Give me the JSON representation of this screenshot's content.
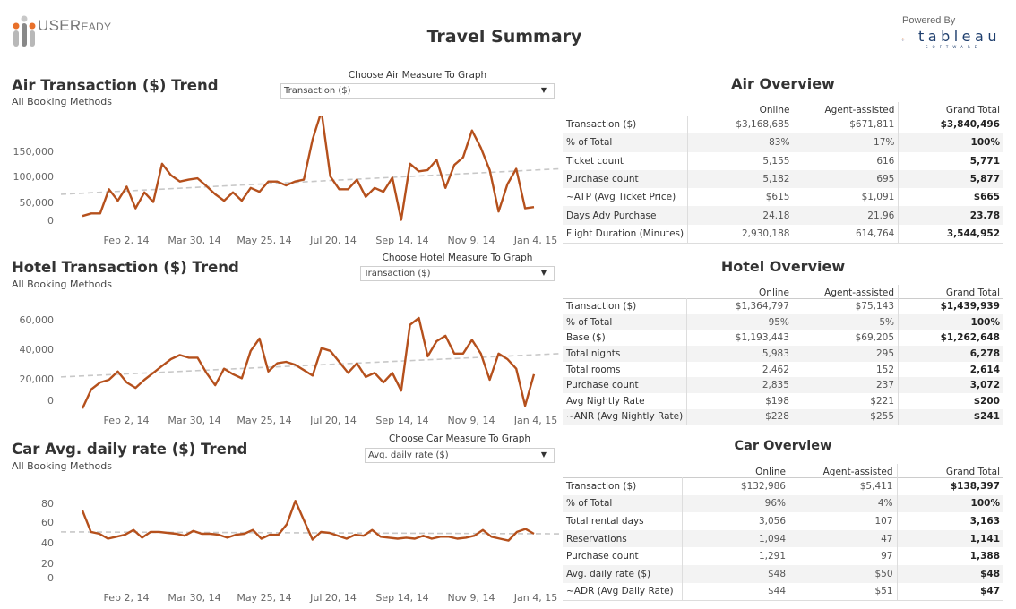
{
  "header": {
    "brand": "USER",
    "brand_suffix": "EADY",
    "title": "Travel Summary",
    "powered_by": "Powered By",
    "tableau_word": "tableau",
    "tableau_sub": "SOFTWARE"
  },
  "colors": {
    "line": "#b5501c",
    "trend": "#c8c8c8",
    "logo_orange": "#e8702a",
    "logo_gray": "#a0a0a0"
  },
  "air_panel": {
    "title": "Air Transaction ($) Trend",
    "subtitle": "All Booking Methods",
    "param_label": "Choose Air Measure To Graph",
    "param_value": "Transaction ($)"
  },
  "hotel_panel": {
    "title": "Hotel Transaction ($) Trend",
    "subtitle": "All Booking Methods",
    "param_label": "Choose Hotel Measure To Graph",
    "param_value": "Transaction ($)"
  },
  "car_panel": {
    "title": "Car Avg. daily rate ($) Trend",
    "subtitle": "All Booking Methods",
    "param_label": "Choose Car Measure To Graph",
    "param_value": "Avg. daily rate ($)"
  },
  "chart_data": [
    {
      "type": "line",
      "title": "Air Transaction ($) Trend",
      "subtitle": "All Booking Methods",
      "xlabel": "",
      "ylabel": "Transaction ($)",
      "x_ticks": [
        "Feb 2, 14",
        "Mar 30, 14",
        "May 25, 14",
        "Jul 20, 14",
        "Sep 14, 14",
        "Nov 9, 14",
        "Jan 4, 15"
      ],
      "y_ticks": [
        "0",
        "50,000",
        "100,000",
        "150,000"
      ],
      "ylim": [
        0,
        160000
      ],
      "trend_line": {
        "start": 52000,
        "end": 92000
      },
      "series": [
        {
          "name": "Transaction ($)",
          "values": [
            18000,
            22000,
            22000,
            60000,
            42000,
            64000,
            30000,
            55000,
            40000,
            100000,
            82000,
            72000,
            75000,
            77000,
            65000,
            52000,
            42000,
            55000,
            42000,
            62000,
            56000,
            72000,
            72000,
            66000,
            72000,
            75000,
            138000,
            182000,
            80000,
            60000,
            60000,
            75000,
            48000,
            62000,
            56000,
            78000,
            12000,
            100000,
            88000,
            90000,
            106000,
            62000,
            98000,
            110000,
            152000,
            125000,
            90000,
            25000,
            68000,
            92000,
            30000,
            32000
          ]
        }
      ]
    },
    {
      "type": "line",
      "title": "Hotel Transaction ($) Trend",
      "subtitle": "All Booking Methods",
      "xlabel": "",
      "ylabel": "Transaction ($)",
      "x_ticks": [
        "Feb 2, 14",
        "Mar 30, 14",
        "May 25, 14",
        "Jul 20, 14",
        "Sep 14, 14",
        "Nov 9, 14",
        "Jan 4, 15"
      ],
      "y_ticks": [
        "0",
        "20,000",
        "40,000",
        "60,000"
      ],
      "ylim": [
        0,
        62000
      ],
      "trend_line": {
        "start": 19000,
        "end": 36000
      },
      "series": [
        {
          "name": "Transaction ($)",
          "values": [
            -4000,
            10000,
            15000,
            17000,
            23000,
            15000,
            11000,
            17000,
            22000,
            27000,
            32000,
            35000,
            33000,
            33000,
            22000,
            13000,
            25000,
            21000,
            18000,
            38000,
            47000,
            23000,
            29000,
            30000,
            28000,
            24000,
            20000,
            40000,
            38000,
            30000,
            22000,
            29000,
            19000,
            22000,
            15000,
            22000,
            9000,
            57000,
            62000,
            34000,
            45000,
            49000,
            36000,
            36000,
            46000,
            36000,
            17000,
            36000,
            32000,
            25000,
            -2000,
            21000
          ]
        }
      ]
    },
    {
      "type": "line",
      "title": "Car Avg. daily rate ($) Trend",
      "subtitle": "All Booking Methods",
      "xlabel": "",
      "ylabel": "Avg. daily rate ($)",
      "x_ticks": [
        "Feb 2, 14",
        "Mar 30, 14",
        "May 25, 14",
        "Jul 20, 14",
        "Sep 14, 14",
        "Nov 9, 14",
        "Jan 4, 15"
      ],
      "y_ticks": [
        "0",
        "20",
        "40",
        "60",
        "80"
      ],
      "ylim": [
        0,
        85
      ],
      "trend_line": {
        "start": 50,
        "end": 48
      },
      "series": [
        {
          "name": "Avg. daily rate ($)",
          "values": [
            72,
            50,
            48,
            43,
            45,
            47,
            52,
            44,
            50,
            50,
            49,
            48,
            46,
            51,
            48,
            48,
            47,
            44,
            47,
            48,
            52,
            43,
            47,
            47,
            58,
            82,
            62,
            42,
            50,
            49,
            46,
            43,
            47,
            46,
            52,
            45,
            44,
            43,
            44,
            43,
            46,
            43,
            45,
            45,
            43,
            44,
            46,
            52,
            45,
            43,
            41,
            50,
            53,
            48
          ]
        }
      ]
    }
  ],
  "air_overview": {
    "title": "Air Overview",
    "columns": [
      "",
      "Online",
      "Agent-assisted",
      "Grand Total"
    ],
    "rows": [
      [
        "Transaction ($)",
        "$3,168,685",
        "$671,811",
        "$3,840,496"
      ],
      [
        "% of Total",
        "83%",
        "17%",
        "100%"
      ],
      [
        "Ticket count",
        "5,155",
        "616",
        "5,771"
      ],
      [
        "Purchase count",
        "5,182",
        "695",
        "5,877"
      ],
      [
        "~ATP (Avg Ticket Price)",
        "$615",
        "$1,091",
        "$665"
      ],
      [
        "Days Adv Purchase",
        "24.18",
        "21.96",
        "23.78"
      ],
      [
        "Flight Duration (Minutes)",
        "2,930,188",
        "614,764",
        "3,544,952"
      ]
    ]
  },
  "hotel_overview": {
    "title": "Hotel Overview",
    "columns": [
      "",
      "Online",
      "Agent-assisted",
      "Grand Total"
    ],
    "rows": [
      [
        "Transaction ($)",
        "$1,364,797",
        "$75,143",
        "$1,439,939"
      ],
      [
        "% of Total",
        "95%",
        "5%",
        "100%"
      ],
      [
        "Base ($)",
        "$1,193,443",
        "$69,205",
        "$1,262,648"
      ],
      [
        "Total nights",
        "5,983",
        "295",
        "6,278"
      ],
      [
        "Total rooms",
        "2,462",
        "152",
        "2,614"
      ],
      [
        "Purchase count",
        "2,835",
        "237",
        "3,072"
      ],
      [
        "Avg Nightly Rate",
        "$198",
        "$221",
        "$200"
      ],
      [
        "~ANR (Avg Nightly Rate)",
        "$228",
        "$255",
        "$241"
      ]
    ]
  },
  "car_overview": {
    "title": "Car Overview",
    "columns": [
      "",
      "Online",
      "Agent-assisted",
      "Grand Total"
    ],
    "rows": [
      [
        "Transaction ($)",
        "$132,986",
        "$5,411",
        "$138,397"
      ],
      [
        "% of Total",
        "96%",
        "4%",
        "100%"
      ],
      [
        "Total rental days",
        "3,056",
        "107",
        "3,163"
      ],
      [
        "Reservations",
        "1,094",
        "47",
        "1,141"
      ],
      [
        "Purchase count",
        "1,291",
        "97",
        "1,388"
      ],
      [
        "Avg. daily rate ($)",
        "$48",
        "$50",
        "$48"
      ],
      [
        "~ADR (Avg Daily Rate)",
        "$44",
        "$51",
        "$47"
      ]
    ]
  }
}
